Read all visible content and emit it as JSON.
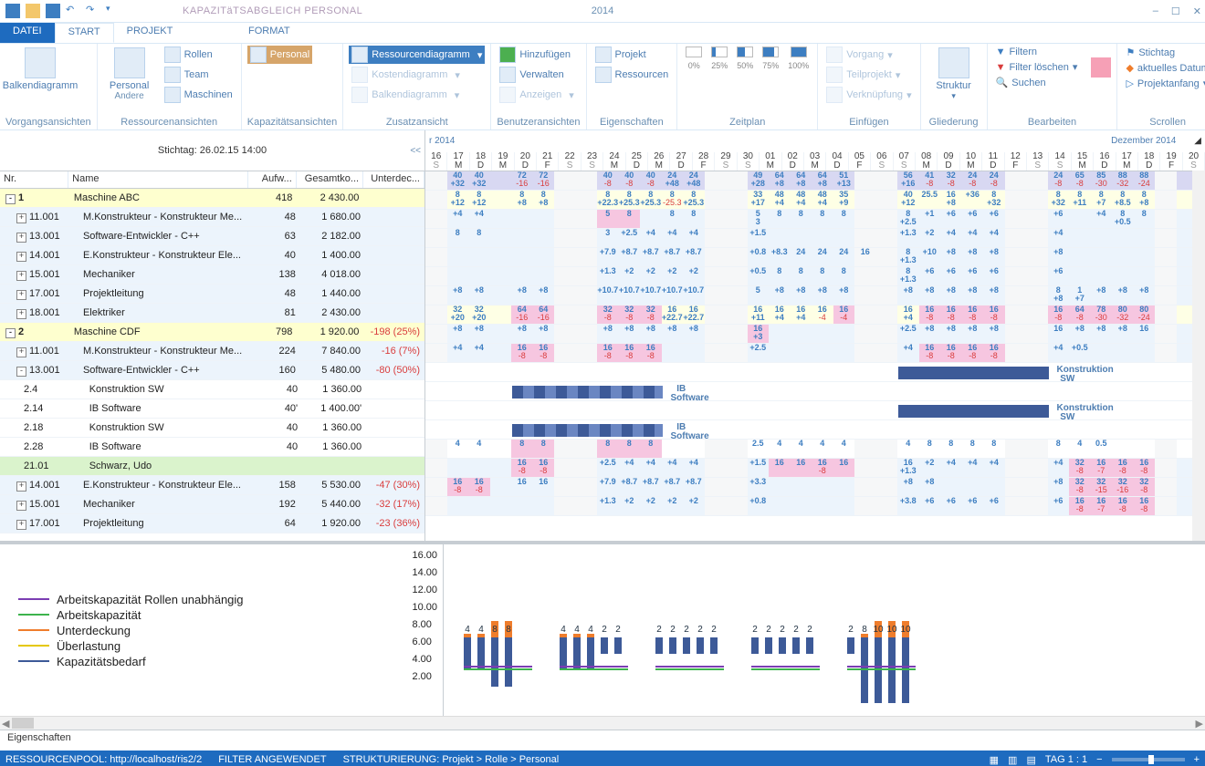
{
  "title_context": "KAPAZITäTSABGLEICH PERSONAL",
  "title_doc": "2014",
  "win": {
    "min": "–",
    "max": "☐",
    "close": "✕"
  },
  "tabs": {
    "file": "DATEI",
    "start": "START",
    "projekt": "PROJEKT",
    "format": "FORMAT"
  },
  "ribbon": {
    "vorgang_label": "Vorgangsansichten",
    "balken": "Balkendiagramm",
    "ressourcen_label": "Ressourcenansichten",
    "personal": "Personal",
    "andere": "Andere",
    "rollen": "Rollen",
    "team": "Team",
    "maschinen": "Maschinen",
    "kapazit_label": "Kapazitätsansichten",
    "personal_btn": "Personal",
    "zusatz_label": "Zusatzansicht",
    "ressourcendiagramm": "Ressourcendiagramm",
    "kosten": "Kostendiagramm",
    "balken2": "Balkendiagramm",
    "benutzer_label": "Benutzeransichten",
    "hinzu": "Hinzufügen",
    "verwalten": "Verwalten",
    "anzeigen": "Anzeigen",
    "eigen_label": "Eigenschaften",
    "projekt": "Projekt",
    "ressourcen": "Ressourcen",
    "zeit_label": "Zeitplan",
    "p0": "0%",
    "p25": "25%",
    "p50": "50%",
    "p75": "75%",
    "p100": "100%",
    "einf_label": "Einfügen",
    "vorgang": "Vorgang",
    "teilprojekt": "Teilprojekt",
    "verknupf": "Verknüpfung",
    "glied_label": "Gliederung",
    "struktur": "Struktur",
    "bearb_label": "Bearbeiten",
    "filtern": "Filtern",
    "filter_loschen": "Filter löschen",
    "suchen": "Suchen",
    "scroll_label": "Scrollen",
    "stichtag": "Stichtag",
    "aktuelles": "aktuelles Datum",
    "projanf": "Projektanfang"
  },
  "stichtag": "Stichtag: 26.02.15 14:00",
  "cols": {
    "nr": "Nr.",
    "name": "Name",
    "aufw": "Aufw...",
    "gesamt": "Gesamtko...",
    "unter": "Unterdec..."
  },
  "rows": [
    {
      "t": "l0",
      "nr": "1",
      "name": "Maschine ABC",
      "a": "418",
      "g": "2 430.00",
      "u": "",
      "tog": "-"
    },
    {
      "t": "l1",
      "nr": "11.001",
      "name": "M.Konstrukteur - Konstrukteur Me...",
      "a": "48",
      "g": "1 680.00",
      "u": "",
      "tog": "+"
    },
    {
      "t": "l1",
      "nr": "13.001",
      "name": "Software-Entwickler - C++",
      "a": "63",
      "g": "2 182.00",
      "u": "",
      "tog": "+"
    },
    {
      "t": "l1",
      "nr": "14.001",
      "name": "E.Konstrukteur - Konstrukteur Ele...",
      "a": "40",
      "g": "1 400.00",
      "u": "",
      "tog": "+"
    },
    {
      "t": "l1",
      "nr": "15.001",
      "name": "Mechaniker",
      "a": "138",
      "g": "4 018.00",
      "u": "",
      "tog": "+"
    },
    {
      "t": "l1",
      "nr": "17.001",
      "name": "Projektleitung",
      "a": "48",
      "g": "1 440.00",
      "u": "",
      "tog": "+"
    },
    {
      "t": "l1",
      "nr": "18.001",
      "name": "Elektriker",
      "a": "81",
      "g": "2 430.00",
      "u": "",
      "tog": "+"
    },
    {
      "t": "l0",
      "nr": "2",
      "name": "Maschine CDF",
      "a": "798",
      "g": "1 920.00",
      "u": "-198 (25%)",
      "tog": "-"
    },
    {
      "t": "l1",
      "nr": "11.001",
      "name": "M.Konstrukteur - Konstrukteur Me...",
      "a": "224",
      "g": "7 840.00",
      "u": "-16 (7%)",
      "tog": "+"
    },
    {
      "t": "l1",
      "nr": "13.001",
      "name": "Software-Entwickler - C++",
      "a": "160",
      "g": "5 480.00",
      "u": "-80 (50%)",
      "tog": "-"
    },
    {
      "t": "l2",
      "nr": "2.4",
      "name": "Konstruktion SW",
      "a": "40",
      "g": "1 360.00",
      "u": ""
    },
    {
      "t": "l2",
      "nr": "2.14",
      "name": "IB Software",
      "a": "40'",
      "g": "1 400.00'",
      "u": ""
    },
    {
      "t": "l2",
      "nr": "2.18",
      "name": "Konstruktion SW",
      "a": "40",
      "g": "1 360.00",
      "u": ""
    },
    {
      "t": "l2",
      "nr": "2.28",
      "name": "IB Software",
      "a": "40",
      "g": "1 360.00",
      "u": ""
    },
    {
      "t": "person",
      "nr": "21.01",
      "name": "Schwarz, Udo",
      "a": "",
      "g": "",
      "u": ""
    },
    {
      "t": "l1",
      "nr": "14.001",
      "name": "E.Konstrukteur - Konstrukteur Ele...",
      "a": "158",
      "g": "5 530.00",
      "u": "-47 (30%)",
      "tog": "+"
    },
    {
      "t": "l1",
      "nr": "15.001",
      "name": "Mechaniker",
      "a": "192",
      "g": "5 440.00",
      "u": "-32 (17%)",
      "tog": "+"
    },
    {
      "t": "l1",
      "nr": "17.001",
      "name": "Projektleitung",
      "a": "64",
      "g": "1 920.00",
      "u": "-23 (36%)",
      "tog": "+"
    }
  ],
  "timeline": {
    "month_left": "r 2014",
    "month_right": "Dezember 2014",
    "days": [
      "16",
      "17",
      "18",
      "19",
      "20",
      "21",
      "22",
      "23",
      "24",
      "25",
      "26",
      "27",
      "28",
      "29",
      "30",
      "01",
      "02",
      "03",
      "04",
      "05",
      "06",
      "07",
      "08",
      "09",
      "10",
      "11",
      "12",
      "13",
      "14",
      "15",
      "16",
      "17",
      "18",
      "19",
      "20"
    ],
    "dow": [
      "S",
      "M",
      "D",
      "M",
      "D",
      "F",
      "S",
      "S",
      "M",
      "D",
      "M",
      "D",
      "F",
      "S",
      "S",
      "M",
      "D",
      "M",
      "D",
      "F",
      "S",
      "S",
      "M",
      "D",
      "M",
      "D",
      "F",
      "S",
      "S",
      "M",
      "D",
      "M",
      "D",
      "F",
      "S"
    ]
  },
  "bars": {
    "ib_software": "IB Software",
    "konstruktion_sw": "Konstruktion SW"
  },
  "legend": {
    "a": "Arbeitskapazität Rollen unabhängig",
    "b": "Arbeitskapazität",
    "c": "Unterdeckung",
    "d": "Überlastung",
    "e": "Kapazitätsbedarf"
  },
  "chart_data": {
    "type": "bar",
    "ylim": [
      0,
      16
    ],
    "yticks": [
      "16.00",
      "14.00",
      "12.00",
      "10.00",
      "8.00",
      "6.00",
      "4.00",
      "2.00"
    ],
    "x": [
      "16",
      "17",
      "18",
      "19",
      "20",
      "21",
      "22",
      "23",
      "24",
      "25",
      "26",
      "27",
      "28",
      "29",
      "30",
      "01",
      "02",
      "03",
      "04",
      "05",
      "06",
      "07",
      "08",
      "09",
      "10",
      "11",
      "12",
      "13",
      "14",
      "15",
      "16",
      "17",
      "18",
      "19",
      "20"
    ],
    "series": [
      {
        "name": "Kapazitätsbedarf",
        "values": [
          0,
          4,
          4,
          6,
          6,
          0,
          0,
          0,
          4,
          4,
          4,
          2,
          2,
          0,
          0,
          2,
          2,
          2,
          2,
          2,
          0,
          0,
          2,
          2,
          2,
          2,
          2,
          0,
          0,
          2,
          8,
          8,
          8,
          8,
          0
        ]
      },
      {
        "name": "Unterdeckung",
        "values": [
          0,
          0.5,
          0.5,
          2,
          2,
          0,
          0,
          0,
          0.5,
          0.5,
          0.5,
          0,
          0,
          0,
          0,
          0,
          0,
          0,
          0,
          0,
          0,
          0,
          0,
          0,
          0,
          0,
          0,
          0,
          0,
          0,
          0.5,
          2,
          2,
          2,
          0
        ]
      }
    ],
    "labels": {
      "1": "4",
      "2": "4",
      "3": "8",
      "4": "8",
      "8": "4",
      "9": "4",
      "10": "4",
      "11": "2",
      "12": "2",
      "15": "2",
      "16": "2",
      "17": "2",
      "18": "2",
      "19": "2",
      "22": "2",
      "23": "2",
      "24": "2",
      "25": "2",
      "26": "2",
      "29": "2",
      "30": "8",
      "31": "10",
      "32": "10",
      "33": "10"
    },
    "arbeitskapazitaet_level": 4,
    "rollen_level": 4
  },
  "eigenschaften": "Eigenschaften",
  "status": {
    "pool": "RESSOURCENPOOL: http://localhost/ris2/2",
    "filter": "FILTER ANGEWENDET",
    "strukt": "STRUKTURIERUNG: Projekt > Rolle > Personal",
    "tag": "TAG 1 : 1"
  }
}
